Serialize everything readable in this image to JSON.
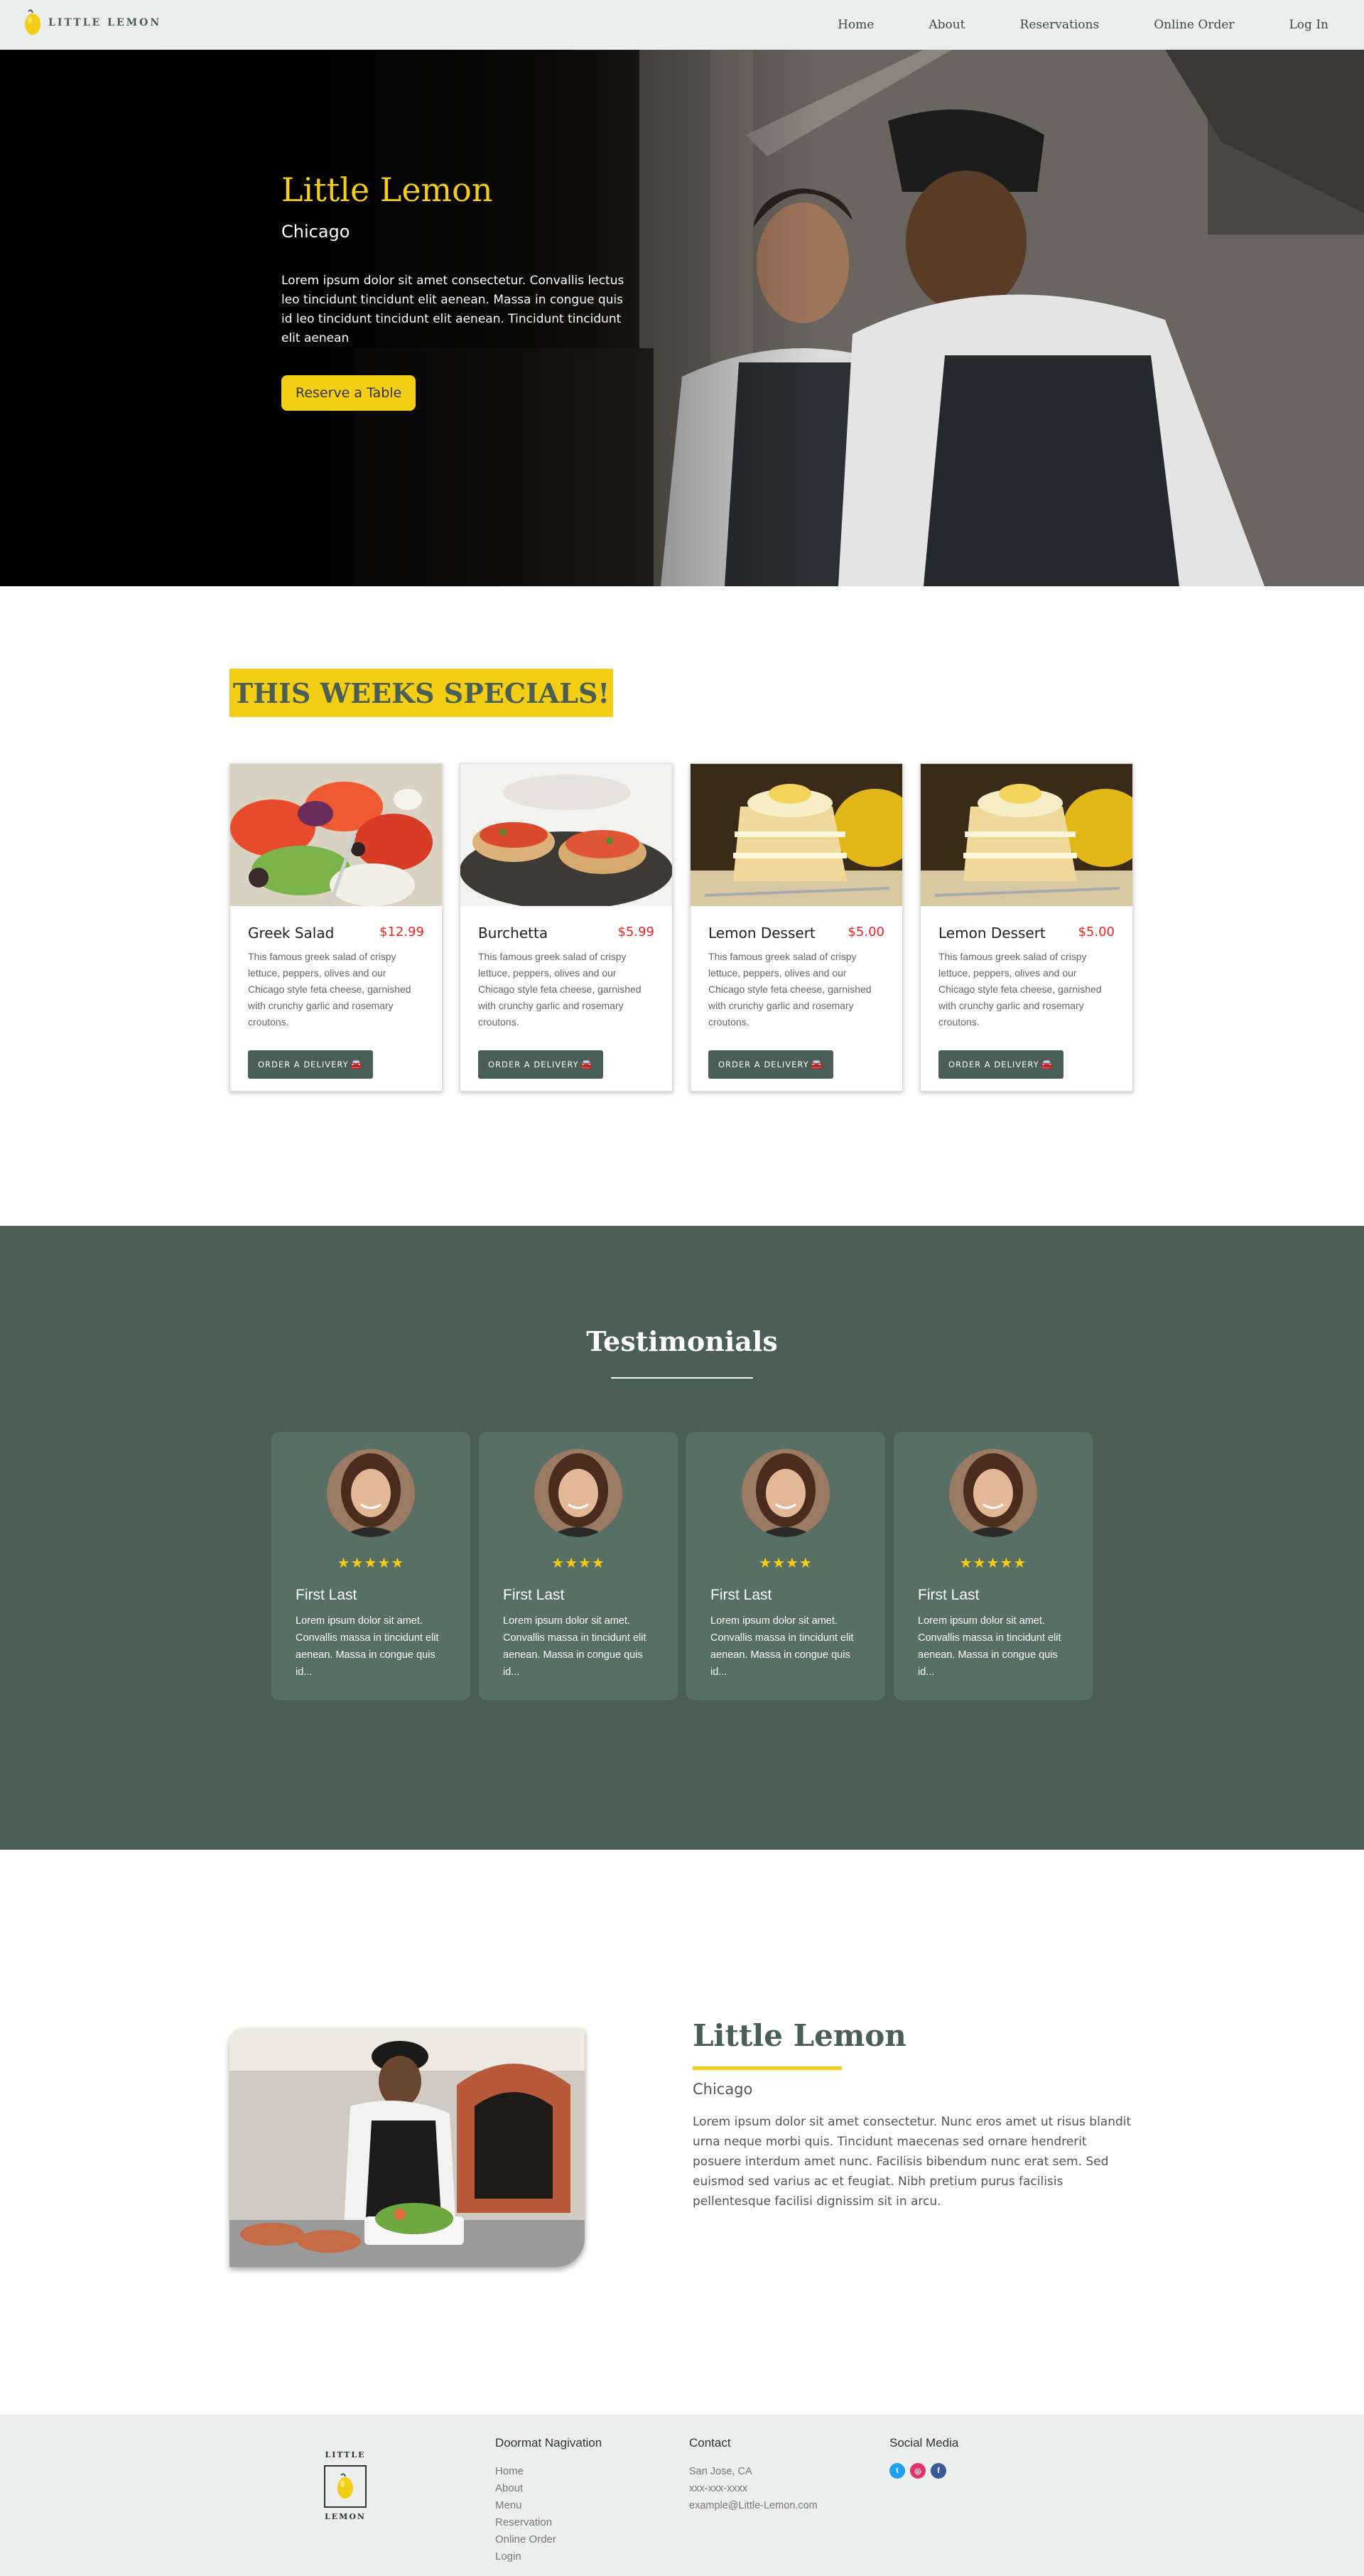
{
  "nav": {
    "logo_text": "LITTLE LEMON",
    "links": [
      "Home",
      "About",
      "Reservations",
      "Online Order",
      "Log In"
    ]
  },
  "hero": {
    "title": "Little Lemon",
    "subtitle": "Chicago",
    "text": "Lorem ipsum dolor sit amet consectetur. Convallis lectus leo tincidunt tincidunt elit aenean. Massa in congue quis id leo tincidunt tincidunt elit aenean. Tincidunt tincidunt elit aenean",
    "button": "Reserve a Table"
  },
  "specials": {
    "heading": "THIS WEEKS SPECIALS!",
    "button_label": "ORDER A DELIVERY",
    "items": [
      {
        "name": "Greek Salad",
        "price": "$12.99",
        "desc": "This famous greek salad of crispy lettuce, peppers, olives and our Chicago style feta cheese, garnished with crunchy garlic and rosemary croutons."
      },
      {
        "name": "Burchetta",
        "price": "$5.99",
        "desc": "This famous greek salad of crispy lettuce, peppers, olives and our Chicago style feta cheese, garnished with crunchy garlic and rosemary croutons."
      },
      {
        "name": "Lemon Dessert",
        "price": "$5.00",
        "desc": "This famous greek salad of crispy lettuce, peppers, olives and our Chicago style feta cheese, garnished with crunchy garlic and rosemary croutons."
      },
      {
        "name": "Lemon Dessert",
        "price": "$5.00",
        "desc": "This famous greek salad of crispy lettuce, peppers, olives and our Chicago style feta cheese, garnished with crunchy garlic and rosemary croutons."
      }
    ]
  },
  "testimonials": {
    "heading": "Testimonials",
    "items": [
      {
        "stars": "★★★★★",
        "rating": 5,
        "name": "First Last",
        "text": "Lorem ipsum dolor sit amet. Convallis massa in tincidunt elit aenean. Massa in congue quis id..."
      },
      {
        "stars": "★★★★",
        "rating": 4,
        "name": "First Last",
        "text": "Lorem ipsum dolor sit amet. Convallis massa in tincidunt elit aenean. Massa in congue quis id..."
      },
      {
        "stars": "★★★★",
        "rating": 4,
        "name": "First Last",
        "text": "Lorem ipsum dolor sit amet. Convallis massa in tincidunt elit aenean. Massa in congue quis id..."
      },
      {
        "stars": "★★★★★",
        "rating": 5,
        "name": "First Last",
        "text": "Lorem ipsum dolor sit amet. Convallis massa in tincidunt elit aenean. Massa in congue quis id..."
      }
    ]
  },
  "about": {
    "title": "Little Lemon",
    "subtitle": "Chicago",
    "text": "Lorem ipsum dolor sit amet consectetur. Nunc eros amet ut risus blandit urna neque morbi quis. Tincidunt maecenas sed ornare hendrerit posuere interdum amet nunc. Facilisis bibendum nunc erat sem. Sed euismod sed varius ac et feugiat. Nibh pretium purus facilisis pellentesque facilisi dignissim sit in arcu."
  },
  "footer": {
    "logo_top": "LITTLE",
    "logo_bottom": "LEMON",
    "nav_heading": "Doormat Nagivation",
    "nav_links": [
      "Home",
      "About",
      "Menu",
      "Reservation",
      "Online Order",
      "Login"
    ],
    "contact_heading": "Contact",
    "contact_lines": [
      "San Jose, CA",
      "xxx-xxx-xxxx",
      "example@Little-Lemon.com"
    ],
    "social_heading": "Social Media",
    "social_icons": [
      "twitter-icon",
      "instagram-icon",
      "facebook-icon"
    ]
  },
  "colors": {
    "primary_green": "#495e57",
    "primary_yellow": "#f4ce14",
    "price_red": "#ee2222",
    "light_gray": "#eceeed"
  }
}
